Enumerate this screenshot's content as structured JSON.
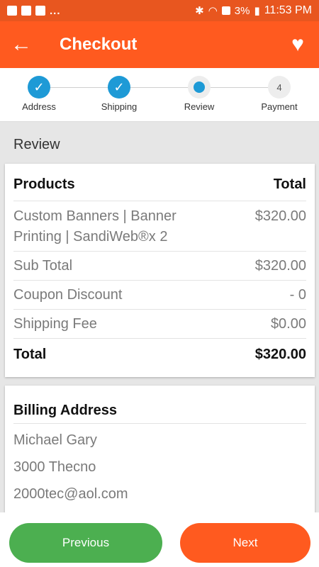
{
  "status_bar": {
    "dots": "...",
    "battery": "3%",
    "time": "11:53 PM"
  },
  "app_bar": {
    "title": "Checkout"
  },
  "stepper": {
    "steps": [
      {
        "label": "Address",
        "state": "done"
      },
      {
        "label": "Shipping",
        "state": "done"
      },
      {
        "label": "Review",
        "state": "active"
      },
      {
        "label": "Payment",
        "state": "pending",
        "number": "4"
      }
    ]
  },
  "section_title": "Review",
  "order": {
    "header_left": "Products",
    "header_right": "Total",
    "product_name": "Custom Banners | Banner Printing | SandiWeb®x 2",
    "product_total": "$320.00",
    "sub_total_label": "Sub Total",
    "sub_total_value": "$320.00",
    "coupon_label": "Coupon Discount",
    "coupon_value": "- 0",
    "shipping_label": "Shipping Fee",
    "shipping_value": "$0.00",
    "total_label": "Total",
    "total_value": "$320.00"
  },
  "billing": {
    "title": "Billing Address",
    "name": "Michael  Gary",
    "street": "3000 Thecno",
    "email": "2000tec@aol.com"
  },
  "buttons": {
    "previous": "Previous",
    "next": "Next"
  },
  "colors": {
    "primary": "#ff5a1f",
    "accent": "#1e9ad6",
    "previous_button": "#4caf50"
  }
}
